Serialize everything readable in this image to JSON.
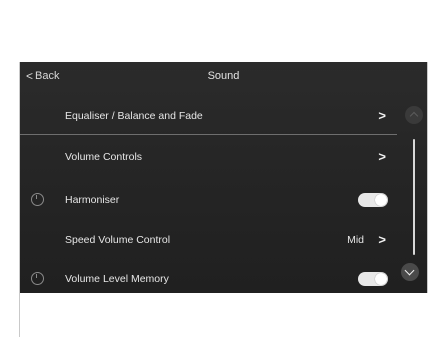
{
  "header": {
    "back_label": "Back",
    "back_chevron": "<",
    "title": "Sound"
  },
  "rows": [
    {
      "label": "Equaliser / Balance and Fade",
      "chevron": ">",
      "icon": ""
    },
    {
      "label": "Volume Controls",
      "chevron": ">",
      "icon": ""
    },
    {
      "label": "Harmoniser",
      "icon": "power-circle-icon",
      "toggle_on": true
    },
    {
      "label": "Speed Volume Control",
      "value": "Mid",
      "chevron": ">",
      "icon": ""
    },
    {
      "label": "Volume Level Memory",
      "icon": "power-circle-icon",
      "toggle_on": true
    }
  ],
  "colors": {
    "background": "#252525",
    "text": "#e6e6e6",
    "toggle": "#e8e8e8"
  }
}
